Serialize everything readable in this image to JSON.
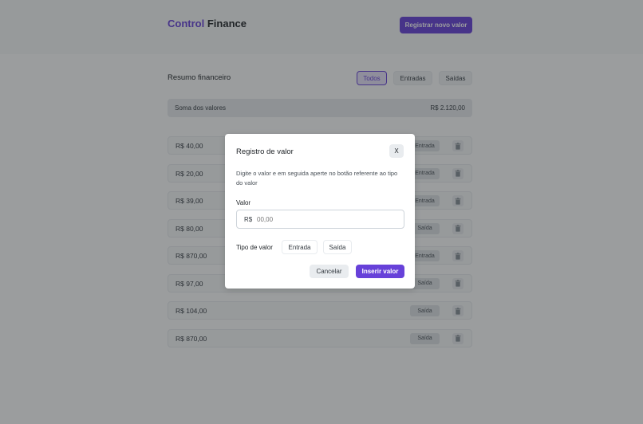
{
  "header": {
    "logo_part1": "Control",
    "logo_part2": "Finance",
    "new_button": "Registrar novo valor"
  },
  "summary": {
    "title": "Resumo financeiro",
    "filters": [
      "Todos",
      "Entradas",
      "Saídas"
    ],
    "active_filter": "Todos",
    "sum_label": "Soma dos valores",
    "sum_value": "R$ 2.120,00"
  },
  "entries": [
    {
      "amount": "R$ 40,00",
      "type": "Entrada"
    },
    {
      "amount": "R$ 20,00",
      "type": "Entrada"
    },
    {
      "amount": "R$ 39,00",
      "type": "Entrada"
    },
    {
      "amount": "R$ 80,00",
      "type": "Saída"
    },
    {
      "amount": "R$ 870,00",
      "type": "Entrada"
    },
    {
      "amount": "R$ 97,00",
      "type": "Saída"
    },
    {
      "amount": "R$ 104,00",
      "type": "Saída"
    },
    {
      "amount": "R$ 870,00",
      "type": "Saída"
    }
  ],
  "modal": {
    "title": "Registro de valor",
    "close_label": "X",
    "description": "Digite o valor e em seguida aperte no botão referente ao tipo do valor",
    "valor_label": "Valor",
    "currency_prefix": "R$",
    "valor_placeholder": "00,00",
    "tipo_label": "Tipo de valor",
    "tipo_entrada": "Entrada",
    "tipo_saida": "Saída",
    "cancel_button": "Cancelar",
    "insert_button": "Inserir valor"
  },
  "icons": {
    "trash": "trash-icon"
  },
  "colors": {
    "accent": "#6741d9"
  }
}
